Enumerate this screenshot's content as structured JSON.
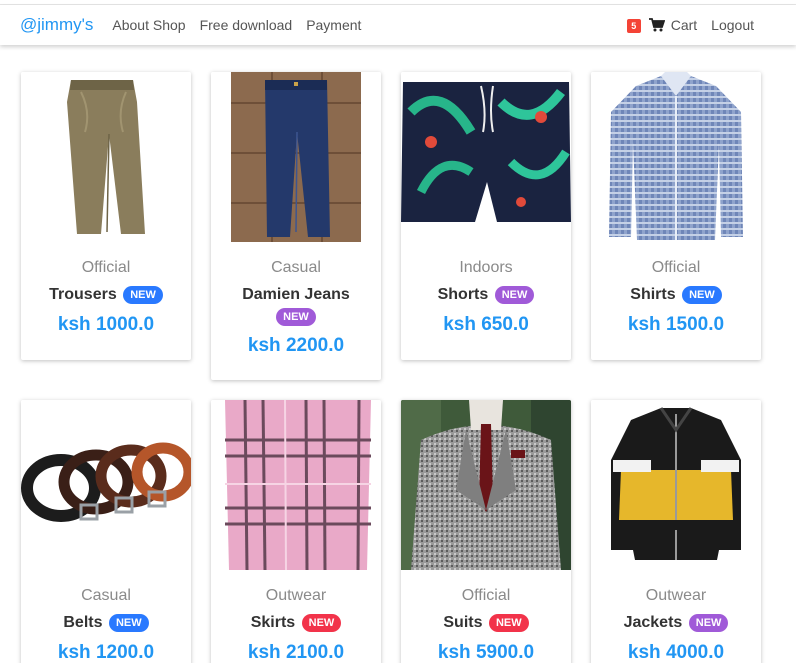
{
  "navbar": {
    "brand": "@jimmy's",
    "links": [
      "About Shop",
      "Free download",
      "Payment"
    ],
    "cart_count": "5",
    "cart_label": "Cart",
    "cart_icon": "shopping-cart-icon",
    "logout_label": "Logout"
  },
  "colors": {
    "accent": "#2196f3",
    "badge_blue": "#2979ff",
    "badge_purple": "#a05ad8",
    "badge_red": "#f2334a",
    "cart_badge": "#f44336"
  },
  "products": [
    {
      "category": "Official",
      "name": "Trousers",
      "badge": "NEW",
      "badge_color": "blue",
      "price": "ksh 1000.0",
      "image": "khaki trousers"
    },
    {
      "category": "Casual",
      "name": "Damien Jeans",
      "badge": "NEW",
      "badge_color": "purple",
      "price": "ksh 2200.0",
      "image": "blue jeans"
    },
    {
      "category": "Indoors",
      "name": "Shorts",
      "badge": "NEW",
      "badge_color": "purple",
      "price": "ksh 650.0",
      "image": "tropical print shorts"
    },
    {
      "category": "Official",
      "name": "Shirts",
      "badge": "NEW",
      "badge_color": "blue",
      "price": "ksh 1500.0",
      "image": "blue check shirt"
    },
    {
      "category": "Casual",
      "name": "Belts",
      "badge": "NEW",
      "badge_color": "blue",
      "price": "ksh 1200.0",
      "image": "leather belts"
    },
    {
      "category": "Outwear",
      "name": "Skirts",
      "badge": "NEW",
      "badge_color": "red",
      "price": "ksh 2100.0",
      "image": "pink plaid skirt"
    },
    {
      "category": "Official",
      "name": "Suits",
      "badge": "NEW",
      "badge_color": "red",
      "price": "ksh 5900.0",
      "image": "grey check suit"
    },
    {
      "category": "Outwear",
      "name": "Jackets",
      "badge": "NEW",
      "badge_color": "purple",
      "price": "ksh 4000.0",
      "image": "yellow black jacket"
    }
  ]
}
